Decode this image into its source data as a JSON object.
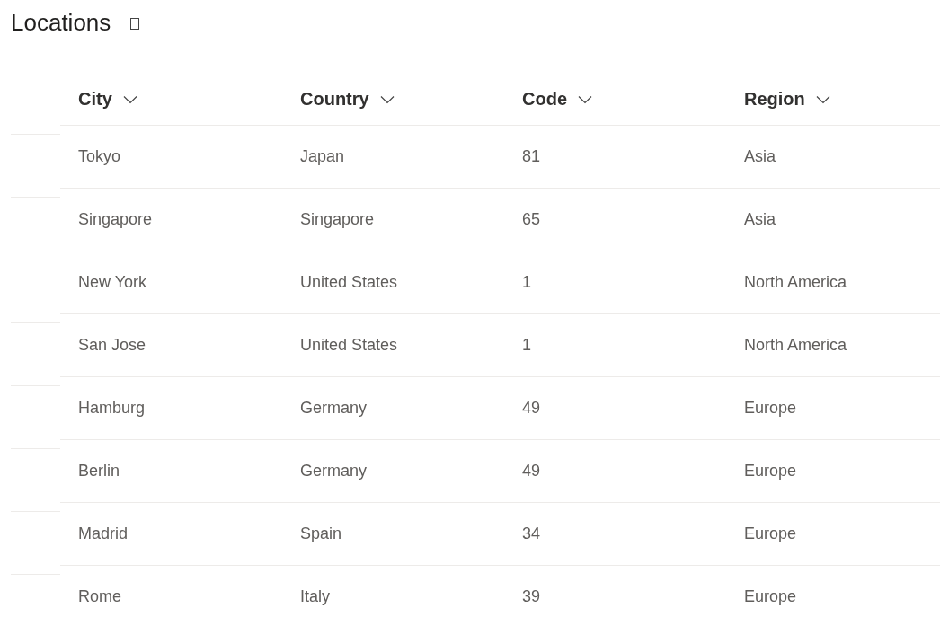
{
  "title": "Locations",
  "table": {
    "columns": [
      "City",
      "Country",
      "Code",
      "Region"
    ],
    "rows": [
      [
        "Tokyo",
        "Japan",
        "81",
        "Asia"
      ],
      [
        "Singapore",
        "Singapore",
        "65",
        "Asia"
      ],
      [
        "New York",
        "United States",
        "1",
        "North America"
      ],
      [
        "San Jose",
        "United States",
        "1",
        "North America"
      ],
      [
        "Hamburg",
        "Germany",
        "49",
        "Europe"
      ],
      [
        "Berlin",
        "Germany",
        "49",
        "Europe"
      ],
      [
        "Madrid",
        "Spain",
        "34",
        "Europe"
      ],
      [
        "Rome",
        "Italy",
        "39",
        "Europe"
      ]
    ]
  }
}
